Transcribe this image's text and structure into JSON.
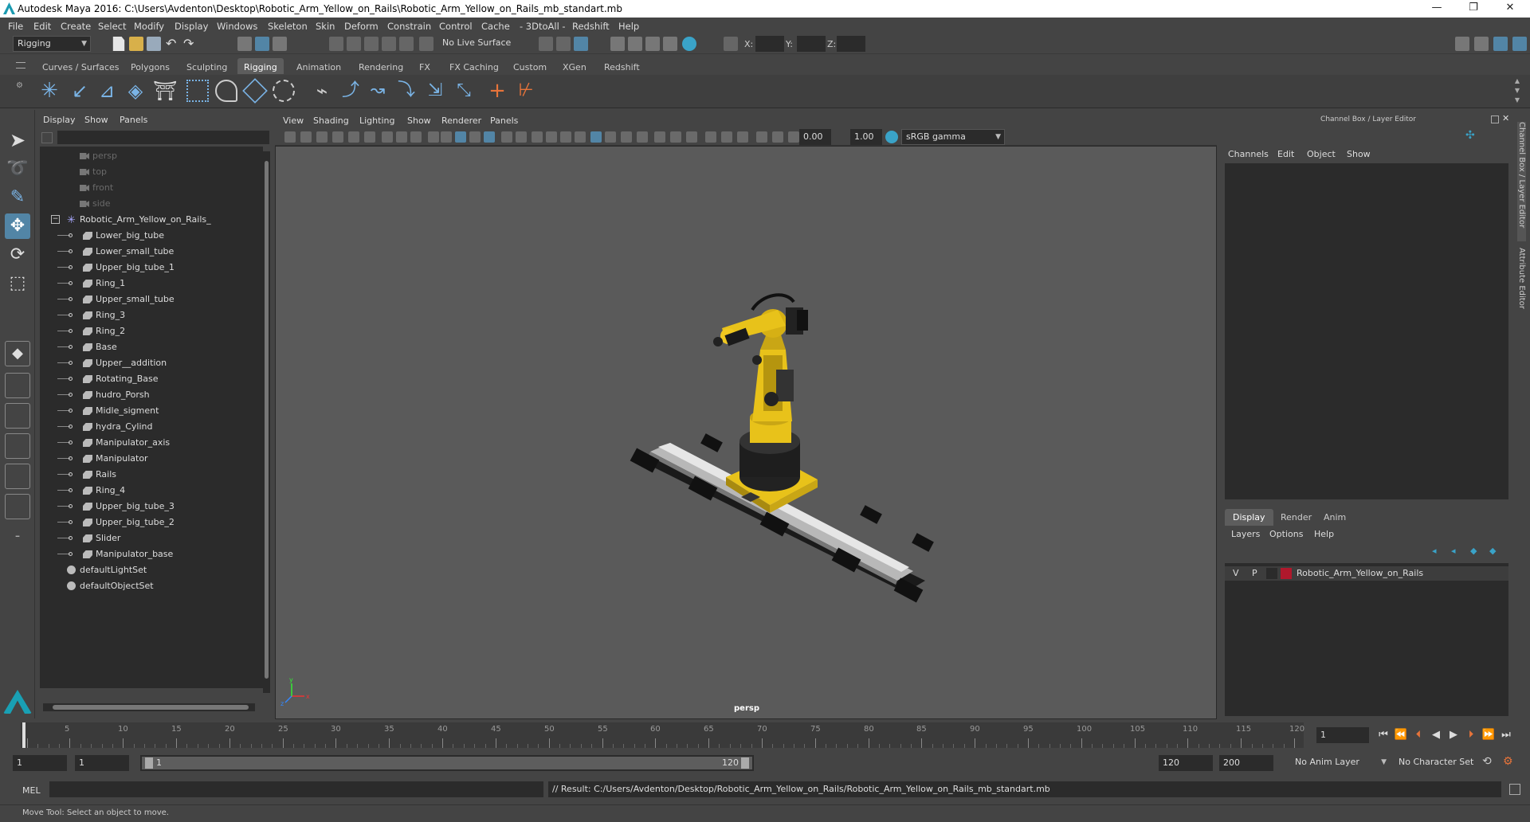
{
  "window": {
    "title": "Autodesk Maya 2016: C:\\Users\\Avdenton\\Desktop\\Robotic_Arm_Yellow_on_Rails\\Robotic_Arm_Yellow_on_Rails_mb_standart.mb",
    "minimize": "—",
    "maximize": "❐",
    "close": "✕"
  },
  "menubar": [
    "File",
    "Edit",
    "Create",
    "Select",
    "Modify",
    "Display",
    "Windows",
    "Skeleton",
    "Skin",
    "Deform",
    "Constrain",
    "Control",
    "Cache",
    "- 3DtoAll -",
    "Redshift",
    "Help"
  ],
  "statusline": {
    "menuset": "Rigging",
    "live_surface": "No Live Surface",
    "x_label": "X:",
    "y_label": "Y:",
    "z_label": "Z:"
  },
  "shelf_tabs": [
    "Curves / Surfaces",
    "Polygons",
    "Sculpting",
    "Rigging",
    "Animation",
    "Rendering",
    "FX",
    "FX Caching",
    "Custom",
    "XGen",
    "Redshift"
  ],
  "shelf_active": "Rigging",
  "outliner": {
    "menu": [
      "Display",
      "Show",
      "Panels"
    ],
    "cameras": [
      "persp",
      "top",
      "front",
      "side"
    ],
    "group": "Robotic_Arm_Yellow_on_Rails_",
    "children": [
      "Lower_big_tube",
      "Lower_small_tube",
      "Upper_big_tube_1",
      "Ring_1",
      "Upper_small_tube",
      "Ring_3",
      "Ring_2",
      "Base",
      "Upper__addition",
      "Rotating_Base",
      "hudro_Porsh",
      "Midle_sigment",
      "hydra_Cylind",
      "Manipulator_axis",
      "Manipulator",
      "Rails",
      "Ring_4",
      "Upper_big_tube_3",
      "Upper_big_tube_2",
      "Slider",
      "Manipulator_base"
    ],
    "sets": [
      "defaultLightSet",
      "defaultObjectSet"
    ]
  },
  "viewport": {
    "menu": [
      "View",
      "Shading",
      "Lighting",
      "Show",
      "Renderer",
      "Panels"
    ],
    "exposure": "0.00",
    "gamma": "1.00",
    "color_space": "sRGB gamma",
    "camera_label": "persp"
  },
  "channelbox": {
    "title": "Channel Box / Layer Editor",
    "menu": [
      "Channels",
      "Edit",
      "Object",
      "Show"
    ],
    "layer_tabs": [
      "Display",
      "Render",
      "Anim"
    ],
    "layer_active": "Display",
    "layer_menu": [
      "Layers",
      "Options",
      "Help"
    ],
    "layer": {
      "v": "V",
      "p": "P",
      "name": "Robotic_Arm_Yellow_on_Rails",
      "color": "#b0182c"
    },
    "side_tabs": [
      "Channel Box / Layer Editor",
      "Attribute Editor"
    ]
  },
  "timeline": {
    "ticks": [
      1,
      5,
      10,
      15,
      20,
      25,
      30,
      35,
      40,
      45,
      50,
      55,
      60,
      65,
      70,
      75,
      80,
      85,
      90,
      95,
      100,
      105,
      110,
      115,
      120
    ],
    "current_frame": "1"
  },
  "range": {
    "start": "1",
    "playback_start": "1",
    "slider_start": "1",
    "slider_end": "120",
    "playback_end": "120",
    "end": "200",
    "anim_layer": "No Anim Layer",
    "char_set": "No Character Set"
  },
  "cmdline": {
    "lang": "MEL",
    "result": "// Result: C:/Users/Avdenton/Desktop/Robotic_Arm_Yellow_on_Rails/Robotic_Arm_Yellow_on_Rails_mb_standart.mb"
  },
  "helpline": "Move Tool: Select an object to move.",
  "colors": {
    "accent": "#5285a6",
    "robot_yellow": "#e8c21a",
    "layer_red": "#b0182c"
  }
}
